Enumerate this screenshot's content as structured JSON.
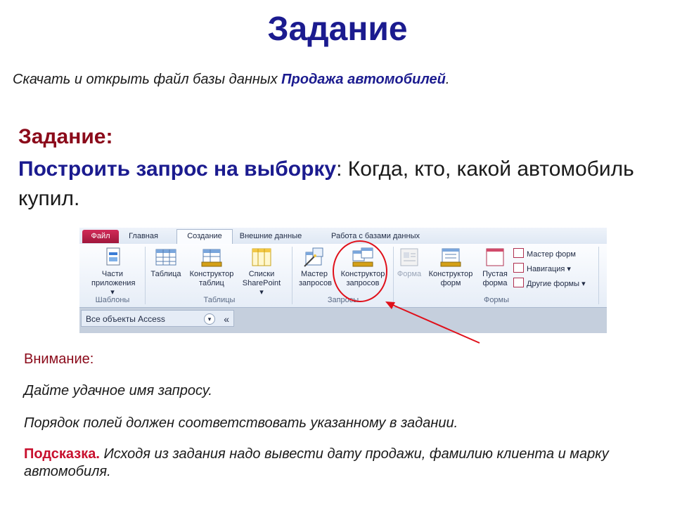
{
  "title": "Задание",
  "intro": {
    "text": "Скачать и открыть файл базы данных ",
    "highlight": "Продажа автомобилей",
    "suffix": "."
  },
  "task": {
    "heading": "Задание:",
    "highlight": "Построить запрос на выборку",
    "text": ": Когда, кто, какой автомобиль купил."
  },
  "ribbon": {
    "tabs": [
      "Файл",
      "Главная",
      "Создание",
      "Внешние данные",
      "Работа с базами данных"
    ],
    "active_tab": "Создание",
    "groups": {
      "templates": {
        "label": "Шаблоны",
        "buttons": [
          "Части приложения ▾"
        ]
      },
      "tables": {
        "label": "Таблицы",
        "buttons": [
          "Таблица",
          "Конструктор таблиц",
          "Списки SharePoint ▾"
        ]
      },
      "queries": {
        "label": "Запросы",
        "buttons": [
          "Мастер запросов",
          "Конструктор запросов"
        ]
      },
      "forms": {
        "label": "Формы",
        "buttons": [
          "Форма",
          "Конструктор форм",
          "Пустая форма"
        ],
        "small_buttons": [
          "Мастер форм",
          "Навигация ▾",
          "Другие формы ▾"
        ]
      }
    },
    "nav_pane": {
      "header": "Все объекты Access",
      "collapse": "«",
      "dropdown": "▾"
    }
  },
  "attention": {
    "title": "Внимание:",
    "line1": "Дайте удачное имя запросу.",
    "line2": "Порядок полей должен соответствовать указанному в задании.",
    "hint_label": "Подсказка.",
    "hint_text": " Исходя из задания надо вывести дату продажи, фамилию клиента и марку автомобиля."
  },
  "colors": {
    "title": "#1b1b8f",
    "heading": "#8b0a1a",
    "hint": "#c8102e",
    "callout": "#e0101a"
  }
}
